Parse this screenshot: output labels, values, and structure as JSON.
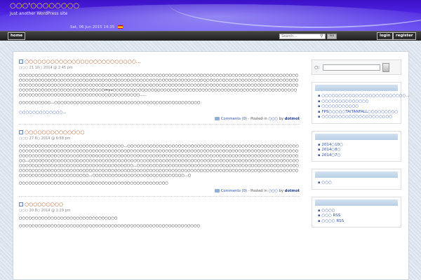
{
  "header": {
    "site_title": "○○○'○○○○○○○○",
    "tagline": "Just another WordPress site",
    "date": "Sat, 06 Jun 2015 14:35"
  },
  "nav": {
    "home": "home",
    "search_placeholder": "Search...",
    "go": "Go",
    "login": "login",
    "register": "register"
  },
  "posts": [
    {
      "title": "○○○○○○○○○○○○○○○○○○○○○○○○○○...",
      "date": "○○○ 21 10○ 2014 @ 2:45 pm",
      "paragraphs": [
        "○○○○○○○○○○○○○○○○○○○○○○○○○○○○○○○○○○○○○○○○○○○○○○○○○○○○○○○○○○○○○○○○○○○○○○○○○○○○○○○○○○○○○○○○○○○○○○○○○○○○○○○○○○○○○○○○○○○○○○○○○○○○○○○○○○○○○○○○○○○○○○○○○○○○○○○○○○○○○○○○○○○○○○○○○○○○○○○○○○○○○○○○○○○○○○○○○○○○○○○○○○○○○○○○○○○○○○○○○○○○○○○○○○○○○○○○○○○○○○○○○○○○○○○○○○○○○○○○○○○○○○○○○○○○○○○○○○○○○○○○○○○○○○○○○○○myu○○○○○○○○○○○○○○○○○○○○○○○○○○○○○○○○○○○○○○○○○○○○○○○○○○○○○○○○○○○○○○○○○○○○○○○○○○○○○○○○○○○○○○○○○○○○○○○○......",
        "○○○○○○○○○○...○○○○○○○○○○○○○○○○○○○○○○○○○○○○○○○○○○○○○○○○○○○○○○"
      ],
      "readmore": "○○○○○○○○○○○○○...",
      "comments": "Comments (0)",
      "posted_in": "- Posted in",
      "category": "○○○",
      "by": "by",
      "author": "dotmot"
    },
    {
      "title": "○○○○○○○○○○○○○○",
      "date": "○○○ 27 8○ 2014 @ 6:58 pm",
      "paragraphs": [
        "○○○○○○○○○○○○○○○○○○○○○○○○○○○○○○○○○...○○○○○○○○○○○○○○○○○○○○○○○○○○○○○○○○○○○○○○○○○○○○○○○○○○○○○○○○○○○○○○○○○○○○○○○○○○○○○○○○○○○○○○○○○○○○○○○○○○○○○○○○○○○○○○○○○○○○○○○○○○○○○○○○○○○○○○○○○○○○○○○○○○○○○○○○○○○○○○○○○○○○○○○○○○○○○○○○○○○○○○○○○○○○○○○○○○○○○○○○○○○○○○○○○○○○○○○○○○○○○○○○○○○○○○○○...○○○○○○○○○○○○○○○○○○○○○○○○○○○○○○○○○○○○○○○○○○○○○○○○○○○○○○○○○○○○○○○○○○○○○○○○○○○○○○○○○○○○○○○○○○○○○○○○○○○○○○○○○○○○○○○○○○○○○○○○○...○○○○○○○○○○○○○○○○○○○○○○○○○○○○○○○○○○○○○○○○○○○○○○○○○○○○○○○○○○○○○○○○○○○○○○○○○○○○○○○○○○○○○○○○○○○○○○○○○○○○○○○○○○○○○○○○○○○○○○○○○○○○○○○○○○○○○○○○○○○○○○○○○○○○○○○○○○○○○○○○○...○○○○○○○○○○○○○○○○○○○○○○○○○○○○○...○",
        "○○○○○○○○○○○○○○○○○○○○○○○○○○○○○○○○○○○○○○○○○○○○○○○"
      ],
      "comments": "Comments (0)",
      "posted_in": "- Posted in",
      "category": "○○○",
      "by": "by",
      "author": "dotmot"
    },
    {
      "title": "○○○○○○○○○",
      "date": "○○○ 20 8○ 2014 @ 1:29 pm",
      "paragraphs": [
        "○○○○○○○○○○○○○○○○○○○○○○○○○○○○○○○",
        "○○○○○○○○○○○○○○○○○○○○○○○○○○○○○○○○○○○○○○○○○○○○○○○○○○○○○○○○○"
      ]
    }
  ],
  "sidebar": {
    "search_label": "○:",
    "recent_posts": [
      "○○○○○○○○○○○○○○○○○○○○○○○○○...",
      "○○○○○○○○○○○○○○",
      "○○○○○○○○○○○",
      "FPS○○○○○TAITANFALL○○○○○○○○○",
      "○○○○○○○○○○○○○○○○○○○○○"
    ],
    "archives": [
      "2014○10○",
      "2014○8○",
      "2014○7○"
    ],
    "categories": [
      "○○○"
    ],
    "meta": [
      "○○○○",
      "○○○ RSS",
      "○○○○ RSS"
    ]
  },
  "colors": {
    "header_bg": "#4b22e0",
    "site_title": "#ffde3a",
    "post_title": "#b5551a",
    "link": "#2a4fb0"
  }
}
